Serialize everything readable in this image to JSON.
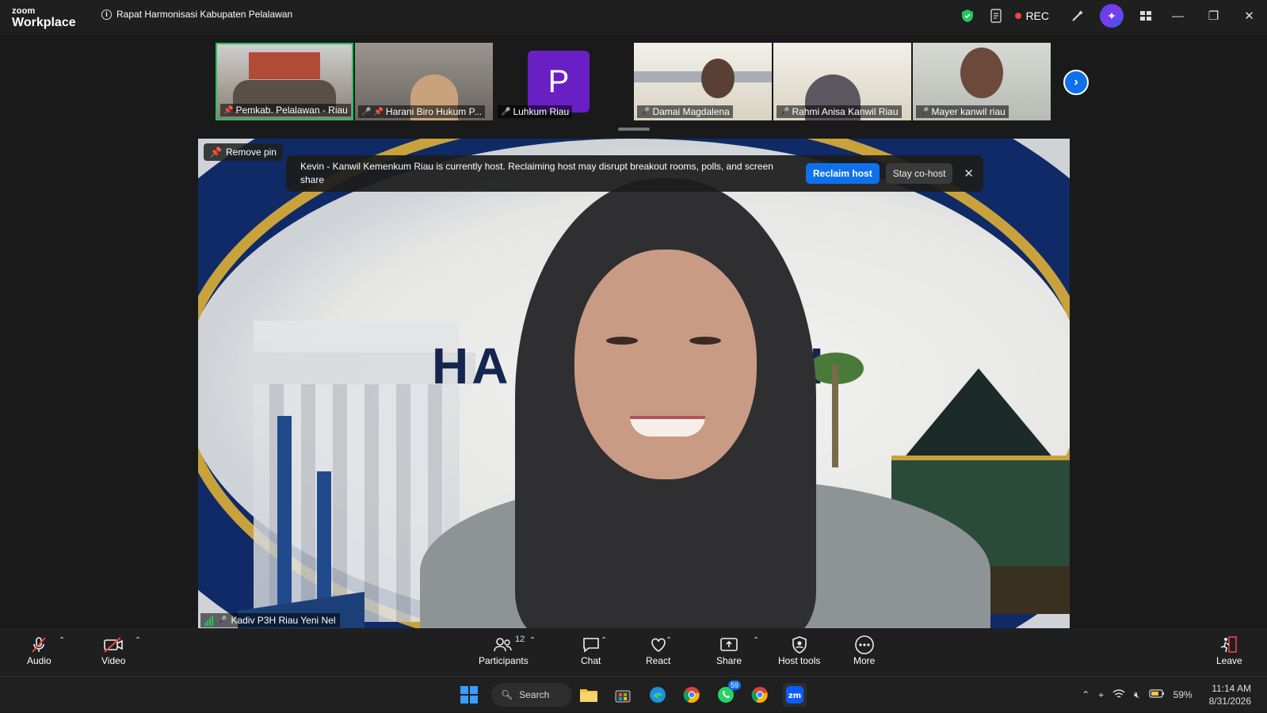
{
  "app": {
    "brand_top": "zoom",
    "brand_bottom": "Workplace",
    "meeting_title": "Rapat Harmonisasi Kabupaten Pelalawan"
  },
  "titlebar": {
    "rec_label": "REC"
  },
  "participants_strip": [
    {
      "name": "Pemkab. Pelalawan - Riau",
      "active": true
    },
    {
      "name": "Harani Biro Hukum P..."
    },
    {
      "name": "Luhkum Riau",
      "avatar_letter": "P"
    },
    {
      "name": "Damai Magdalena"
    },
    {
      "name": "Rahmi Anisa Kanwil Riau"
    },
    {
      "name": "Mayer kanwil riau"
    }
  ],
  "stage": {
    "remove_pin_label": "Remove pin",
    "speaker_name": "Kadiv P3H Riau Yeni Nel",
    "background_text_left": "HA",
    "background_text_right": "SI"
  },
  "host_banner": {
    "message": "Kevin - Kanwil Kemenkum Riau is currently host. Reclaiming host may disrupt breakout rooms, polls, and screen share",
    "reclaim_label": "Reclaim host",
    "stay_label": "Stay co-host"
  },
  "toolbar": {
    "audio": "Audio",
    "video": "Video",
    "participants": "Participants",
    "participants_count": "12",
    "chat": "Chat",
    "react": "React",
    "share": "Share",
    "host_tools": "Host tools",
    "more": "More",
    "leave": "Leave"
  },
  "taskbar": {
    "search_label": "Search",
    "whatsapp_badge": "59",
    "battery": "59%",
    "time": "11:14 AM",
    "date": "8/31/2026"
  },
  "colors": {
    "accent": "#0e71eb",
    "active_border": "#22c55e",
    "muted": "#ef4444"
  }
}
